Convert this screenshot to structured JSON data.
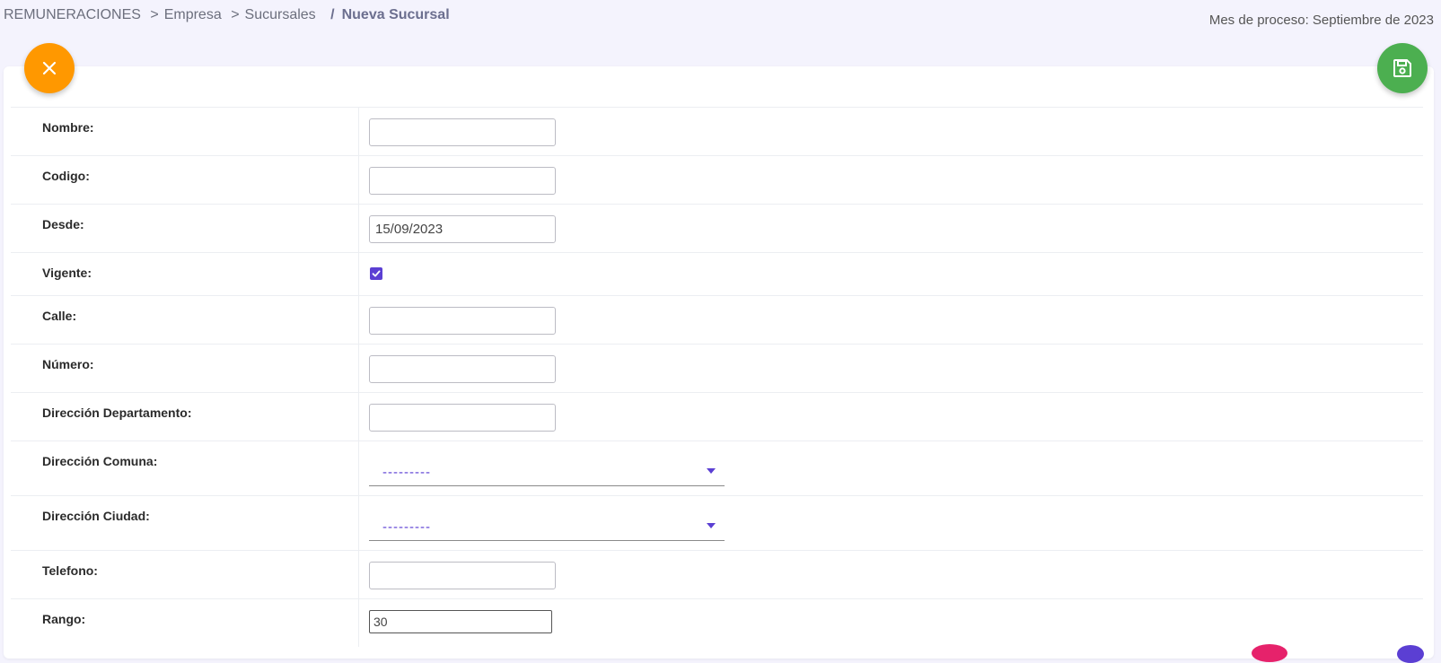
{
  "breadcrumb": {
    "root": "REMUNERACIONES",
    "level1": "Empresa",
    "level2": "Sucursales",
    "current": "Nueva Sucursal"
  },
  "period_label": "Mes de proceso: Septiembre de 2023",
  "actions": {
    "close_icon": "close-icon",
    "save_icon": "floppy-disk-icon",
    "close_color": "#ff9800",
    "save_color": "#4caf50"
  },
  "form": {
    "nombre": {
      "label": "Nombre:",
      "value": ""
    },
    "codigo": {
      "label": "Codigo:",
      "value": ""
    },
    "desde": {
      "label": "Desde:",
      "value": "15/09/2023"
    },
    "vigente": {
      "label": "Vigente:",
      "checked": true
    },
    "calle": {
      "label": "Calle:",
      "value": ""
    },
    "numero": {
      "label": "Número:",
      "value": ""
    },
    "departamento": {
      "label": "Dirección Departamento:",
      "value": ""
    },
    "comuna": {
      "label": "Dirección Comuna:",
      "selected": "---------"
    },
    "ciudad": {
      "label": "Dirección Ciudad:",
      "selected": "---------"
    },
    "telefono": {
      "label": "Telefono:",
      "value": ""
    },
    "rango": {
      "label": "Rango:",
      "value": "30"
    }
  },
  "accent_color": "#5b3fd3"
}
